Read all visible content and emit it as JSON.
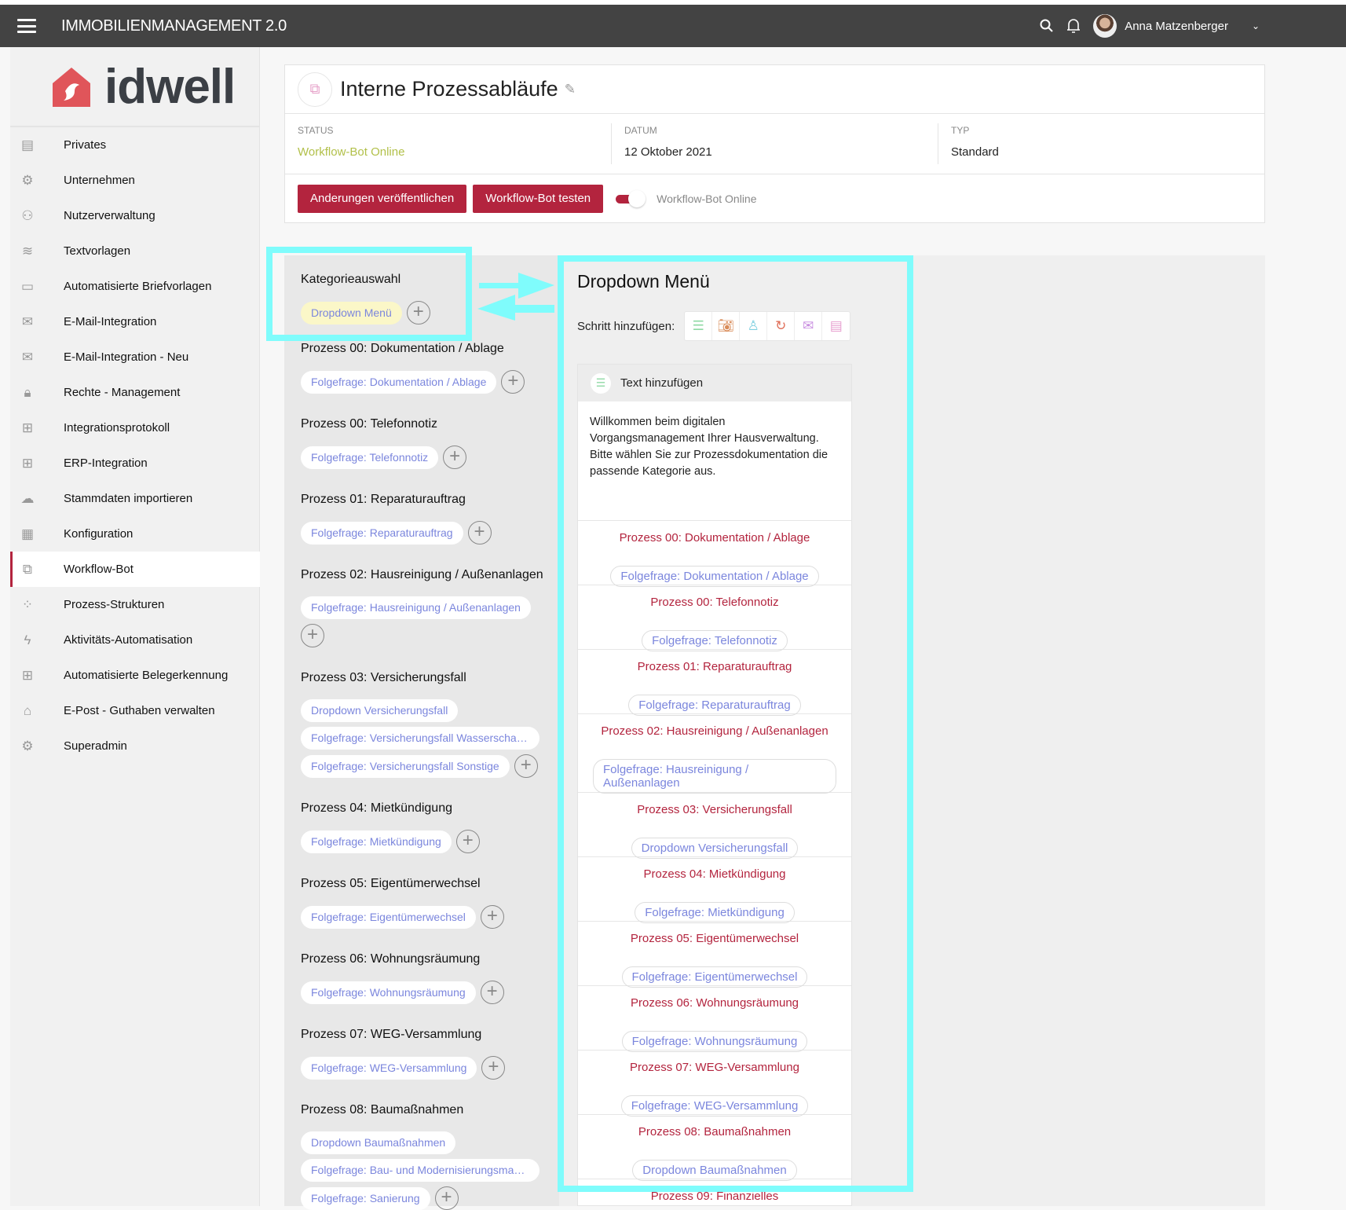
{
  "topbar": {
    "title": "IMMOBILIENMANAGEMENT 2.0",
    "user": "Anna Matzenberger"
  },
  "logo": {
    "text": "idwell"
  },
  "sidebar": {
    "items": [
      {
        "label": "Privates",
        "icon": "id-card-icon",
        "g": "▤"
      },
      {
        "label": "Unternehmen",
        "icon": "gear-icon",
        "g": "⚙"
      },
      {
        "label": "Nutzerverwaltung",
        "icon": "users-icon",
        "g": "⚇"
      },
      {
        "label": "Textvorlagen",
        "icon": "layers-icon",
        "g": "≋"
      },
      {
        "label": "Automatisierte Briefvorlagen",
        "icon": "document-icon",
        "g": "▭"
      },
      {
        "label": "E-Mail-Integration",
        "icon": "mail-icon",
        "g": "✉"
      },
      {
        "label": "E-Mail-Integration - Neu",
        "icon": "mail-icon",
        "g": "✉"
      },
      {
        "label": "Rechte - Management",
        "icon": "lock-icon",
        "g": "🔒︎"
      },
      {
        "label": "Integrationsprotokoll",
        "icon": "network-icon",
        "g": "⊞"
      },
      {
        "label": "ERP-Integration",
        "icon": "network-icon",
        "g": "⊞"
      },
      {
        "label": "Stammdaten importieren",
        "icon": "cloud-upload-icon",
        "g": "☁"
      },
      {
        "label": "Konfiguration",
        "icon": "grid-icon",
        "g": "▦"
      },
      {
        "label": "Workflow-Bot",
        "icon": "workflow-icon",
        "g": "⧉"
      },
      {
        "label": "Prozess-Strukturen",
        "icon": "circles-icon",
        "g": "⁘"
      },
      {
        "label": "Aktivitäts-Automatisation",
        "icon": "bolt-icon",
        "g": "ϟ"
      },
      {
        "label": "Automatisierte Belegerkennung",
        "icon": "network-icon",
        "g": "⊞"
      },
      {
        "label": "E-Post - Guthaben verwalten",
        "icon": "mailbox-icon",
        "g": "⌂"
      },
      {
        "label": "Superadmin",
        "icon": "gear-icon",
        "g": "⚙"
      }
    ],
    "active": 12
  },
  "header": {
    "title": "Interne Prozessabläufe",
    "status_label": "STATUS",
    "status_value": "Workflow-Bot Online",
    "date_label": "DATUM",
    "date_value": "12 Oktober 2021",
    "type_label": "TYP",
    "type_value": "Standard",
    "publish_button": "Anderungen veröffentlichen",
    "test_button": "Workflow-Bot testen",
    "toggle_label": "Workflow-Bot Online",
    "toggle_on": true
  },
  "left": {
    "groups": [
      {
        "title": "Kategorieauswahl",
        "chips": [
          "Dropdown Menü"
        ],
        "yellow": true
      },
      {
        "title": "Prozess 00: Dokumentation / Ablage",
        "chips": [
          "Folgefrage: Dokumentation / Ablage"
        ]
      },
      {
        "title": "Prozess 00: Telefonnotiz",
        "chips": [
          "Folgefrage: Telefonnotiz"
        ]
      },
      {
        "title": "Prozess 01: Reparaturauftrag",
        "chips": [
          "Folgefrage: Reparaturauftrag"
        ]
      },
      {
        "title": "Prozess 02: Hausreinigung / Außenanlagen",
        "chips": [
          "Folgefrage: Hausreinigung / Außenanlagen"
        ],
        "wrap": true
      },
      {
        "title": "Prozess 03: Versicherungsfall",
        "chips": [
          "Dropdown Versicherungsfall",
          "Folgefrage: Versicherungsfall Wasserschaden",
          "Folgefrage: Versicherungsfall Sonstige"
        ]
      },
      {
        "title": "Prozess 04: Mietkündigung",
        "chips": [
          "Folgefrage: Mietkündigung"
        ]
      },
      {
        "title": "Prozess 05: Eigentümerwechsel",
        "chips": [
          "Folgefrage: Eigentümerwechsel"
        ]
      },
      {
        "title": "Prozess 06: Wohnungsräumung",
        "chips": [
          "Folgefrage: Wohnungsräumung"
        ]
      },
      {
        "title": "Prozess 07: WEG-Versammlung",
        "chips": [
          "Folgefrage: WEG-Versammlung"
        ]
      },
      {
        "title": "Prozess 08: Baumaßnahmen",
        "chips": [
          "Dropdown Baumaßnahmen",
          "Folgefrage: Bau- und Modernisierungsmaßnahmen",
          "Folgefrage: Sanierung"
        ]
      }
    ]
  },
  "right": {
    "title": "Dropdown Menü",
    "step_label": "Schritt hinzufügen:",
    "step_icons": [
      {
        "name": "text-icon",
        "g": "☰",
        "color": "#8fd9a4"
      },
      {
        "name": "camera-icon",
        "g": "📷︎",
        "color": "#d98c5a"
      },
      {
        "name": "user-icon",
        "g": "♙",
        "color": "#7fd0e0"
      },
      {
        "name": "redirect-icon",
        "g": "↻",
        "color": "#e0705a"
      },
      {
        "name": "mail-icon",
        "g": "✉",
        "color": "#c98ee0"
      },
      {
        "name": "file-icon",
        "g": "▤",
        "color": "#e7a0d0"
      }
    ],
    "card_title": "Text hinzufügen",
    "text": "Willkommen beim digitalen Vorgangsmanagement Ihrer Hausverwaltung. Bitte wählen Sie zur Prozessdokumentation die passende Kategorie aus.",
    "sections": [
      {
        "title": "Prozess 00: Dokumentation / Ablage",
        "chip": "Folgefrage: Dokumentation / Ablage"
      },
      {
        "title": "Prozess 00: Telefonnotiz",
        "chip": "Folgefrage: Telefonnotiz"
      },
      {
        "title": "Prozess 01: Reparaturauftrag",
        "chip": "Folgefrage: Reparaturauftrag"
      },
      {
        "title": "Prozess 02: Hausreinigung / Außenanlagen",
        "chip": "Folgefrage: Hausreinigung / Außenanlagen",
        "tall": true
      },
      {
        "title": "Prozess 03: Versicherungsfall",
        "chip": "Dropdown Versicherungsfall"
      },
      {
        "title": "Prozess 04: Mietkündigung",
        "chip": "Folgefrage: Mietkündigung"
      },
      {
        "title": "Prozess 05: Eigentümerwechsel",
        "chip": "Folgefrage: Eigentümerwechsel"
      },
      {
        "title": "Prozess 06: Wohnungsräumung",
        "chip": "Folgefrage: Wohnungsräumung"
      },
      {
        "title": "Prozess 07: WEG-Versammlung",
        "chip": "Folgefrage: WEG-Versammlung"
      },
      {
        "title": "Prozess 08: Baumaßnahmen",
        "chip": "Dropdown Baumaßnahmen"
      },
      {
        "title": "Prozess 09: Finanzielles",
        "chip": ""
      }
    ]
  },
  "colors": {
    "accent": "#b3243e",
    "highlight": "#7ffcfc",
    "chip_text": "#7b86dd",
    "status": "#b2c04a"
  }
}
